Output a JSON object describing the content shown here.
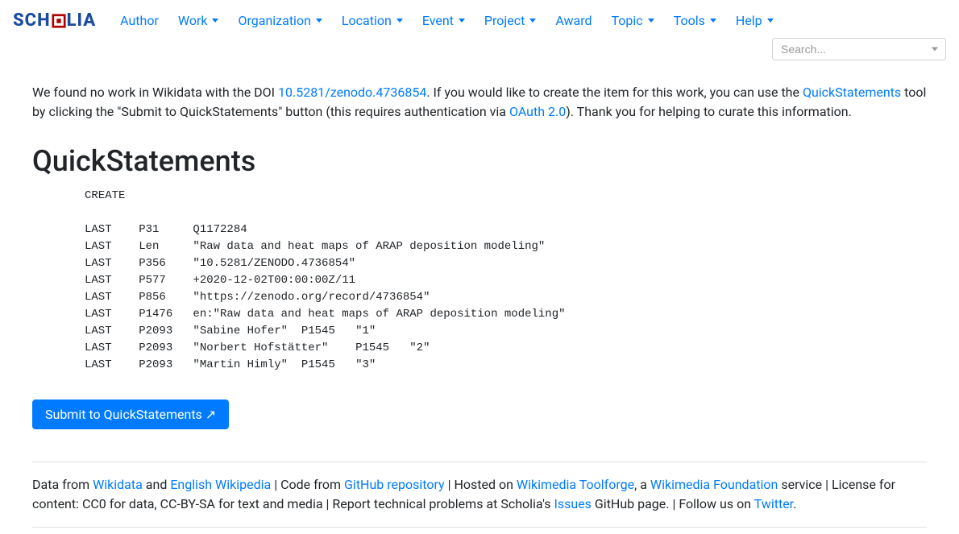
{
  "nav": {
    "brand": "SCHOLIA",
    "items": [
      {
        "label": "Author",
        "dropdown": false
      },
      {
        "label": "Work",
        "dropdown": true
      },
      {
        "label": "Organization",
        "dropdown": true
      },
      {
        "label": "Location",
        "dropdown": true
      },
      {
        "label": "Event",
        "dropdown": true
      },
      {
        "label": "Project",
        "dropdown": true
      },
      {
        "label": "Award",
        "dropdown": false
      },
      {
        "label": "Topic",
        "dropdown": true
      },
      {
        "label": "Tools",
        "dropdown": true
      },
      {
        "label": "Help",
        "dropdown": true
      }
    ],
    "search_placeholder": "Search..."
  },
  "intro": {
    "text1": "We found no work in Wikidata with the DOI ",
    "doi_link": "10.5281/zenodo.4736854",
    "text2": ". If you would like to create the item for this work, you can use the ",
    "qs_link": "QuickStatements",
    "text3": " tool by clicking the \"Submit to QuickStatements\" button (this requires authentication via ",
    "oauth_link": "OAuth 2.0",
    "text4": "). Thank you for helping to curate this information."
  },
  "heading": "QuickStatements",
  "quickstatements": "CREATE\n\nLAST\tP31\tQ1172284\nLAST\tLen\t\"Raw data and heat maps of ARAP deposition modeling\"\nLAST\tP356\t\"10.5281/ZENODO.4736854\"\nLAST\tP577\t+2020-12-02T00:00:00Z/11\nLAST\tP856\t\"https://zenodo.org/record/4736854\"\nLAST\tP1476\ten:\"Raw data and heat maps of ARAP deposition modeling\"\nLAST\tP2093\t\"Sabine Hofer\"\tP1545\t\"1\"\nLAST\tP2093\t\"Norbert Hofstätter\"\tP1545\t\"2\"\nLAST\tP2093\t\"Martin Himly\"\tP1545\t\"3\"",
  "submit_button": "Submit to QuickStatements ↗",
  "footer": {
    "text1": "Data from ",
    "wikidata": "Wikidata",
    "text2": " and ",
    "enwiki": "English Wikipedia",
    "text3": " | Code from ",
    "github": "GitHub repository",
    "text4": " | Hosted on ",
    "toolforge": "Wikimedia Toolforge",
    "text5": ", a ",
    "wmf": "Wikimedia Foundation",
    "text6": " service | License for content: CC0 for data, CC-BY-SA for text and media | Report technical problems at Scholia's ",
    "issues": "Issues",
    "text7": " GitHub page. | Follow us on ",
    "twitter": "Twitter",
    "text8": "."
  }
}
